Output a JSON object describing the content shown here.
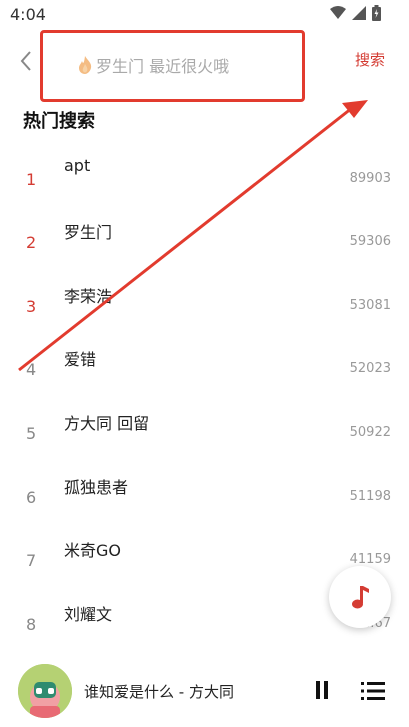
{
  "status_bar": {
    "time": "4:04"
  },
  "header": {
    "back_icon": "chevron-left-icon",
    "search_placeholder": "罗生门 最近很火哦",
    "search_button_label": "搜索"
  },
  "hot_search": {
    "title": "热门搜索",
    "items": [
      {
        "rank": "1",
        "term": "apt",
        "count": "89903"
      },
      {
        "rank": "2",
        "term": "罗生门",
        "count": "59306"
      },
      {
        "rank": "3",
        "term": "李荣浩",
        "count": "53081"
      },
      {
        "rank": "4",
        "term": "爱错",
        "count": "52023"
      },
      {
        "rank": "5",
        "term": "方大同 回留",
        "count": "50922"
      },
      {
        "rank": "6",
        "term": "孤独患者",
        "count": "51198"
      },
      {
        "rank": "7",
        "term": "米奇GO",
        "count": "41159"
      },
      {
        "rank": "8",
        "term": "刘耀文",
        "count": "...67"
      }
    ]
  },
  "player": {
    "now_playing": "谁知爱是什么 - 方大同"
  },
  "colors": {
    "accent": "#d43c33",
    "annotation": "#e23b2e",
    "rank_default": "#888888"
  }
}
